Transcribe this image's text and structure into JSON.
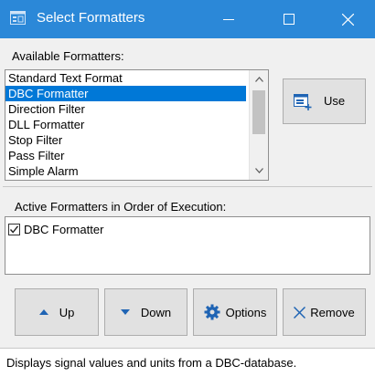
{
  "window": {
    "title": "Select Formatters"
  },
  "available": {
    "label": "Available Formatters:",
    "items": [
      "Standard Text Format",
      "DBC Formatter",
      "Direction Filter",
      "DLL Formatter",
      "Stop Filter",
      "Pass Filter",
      "Simple Alarm"
    ],
    "selected_index": 1
  },
  "use_button": {
    "label": "Use"
  },
  "active": {
    "label": "Active Formatters in Order of Execution:",
    "items": [
      {
        "label": "DBC Formatter",
        "checked": true
      }
    ]
  },
  "buttons": {
    "up": "Up",
    "down": "Down",
    "options": "Options",
    "remove": "Remove"
  },
  "status": {
    "text": "Displays signal values and units from a DBC-database."
  },
  "colors": {
    "titlebar": "#2b88d8",
    "selection": "#0078d7",
    "icon_blue": "#1f64b4"
  }
}
